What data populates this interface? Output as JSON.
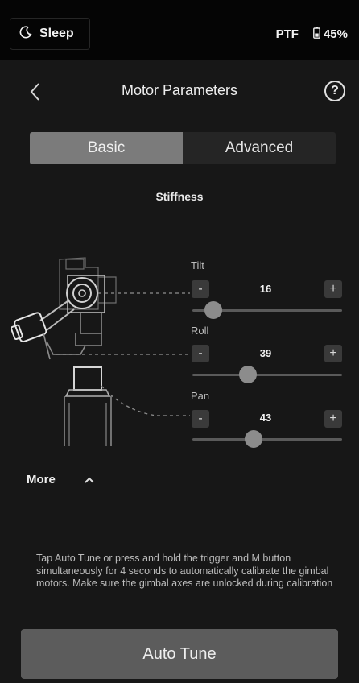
{
  "status_bar": {
    "sleep_label": "Sleep",
    "mode": "PTF",
    "battery": "45%",
    "sleep_icon": "moon-icon",
    "battery_icon": "battery-icon"
  },
  "header": {
    "title": "Motor Parameters",
    "help": "?",
    "back_icon": "chevron-left-icon"
  },
  "tabs": [
    {
      "label": "Basic",
      "active": true
    },
    {
      "label": "Advanced",
      "active": false
    }
  ],
  "section_title": "Stiffness",
  "axes": [
    {
      "label": "Tilt",
      "value": "16",
      "fraction": 0.14
    },
    {
      "label": "Roll",
      "value": "39",
      "fraction": 0.37
    },
    {
      "label": "Pan",
      "value": "43",
      "fraction": 0.41
    }
  ],
  "stepper": {
    "minus": "-",
    "plus": "+"
  },
  "more": {
    "label": "More",
    "icon": "chevron-up-icon"
  },
  "info_text": "Tap Auto Tune or press and hold the trigger and M button simultaneously for 4 seconds to automatically calibrate the gimbal motors. Make sure the gimbal axes are unlocked during calibration",
  "auto_tune_label": "Auto Tune",
  "colors": {
    "background": "#171717",
    "status_bar": "#050505",
    "active_tab": "#7b7b7b",
    "button": "#5c5c5c"
  }
}
